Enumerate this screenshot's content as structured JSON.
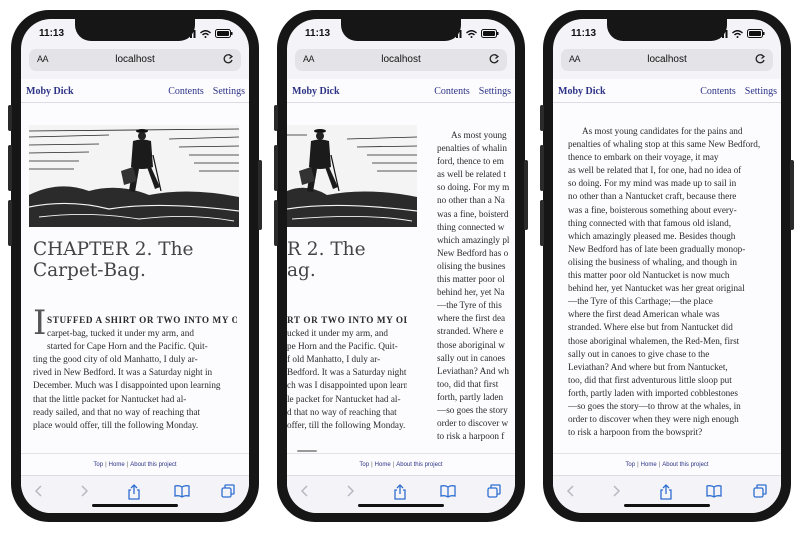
{
  "status": {
    "time": "11:13"
  },
  "browser": {
    "aa_label": "AA",
    "url": "localhost"
  },
  "nav": {
    "title": "Moby Dick",
    "contents": "Contents",
    "settings": "Settings"
  },
  "chapter": {
    "title_line1": "CHAPTER 2. The",
    "title_line2": "Carpet-Bag.",
    "clipped_title_line1": "R 2. The",
    "clipped_title_line2": "ag.",
    "drop_cap": "I",
    "p1_lines": [
      "STUFFED A SHIRT OR TWO INTO MY OLD",
      "carpet-bag, tucked it under my arm, and",
      "started for Cape Horn and the Pacific. Quit-",
      "ting the good city of old Manhatto, I duly ar-",
      "rived in New Bedford. It was a Saturday night in",
      "December. Much was I disappointed upon learning",
      "that the little packet for Nantucket had al-",
      "ready sailed, and that no way of reaching that",
      "place would offer, till the following Monday."
    ],
    "p1_clipped_lines": [
      "RT OR TWO INTO MY OLD",
      "ucked it under my arm, and",
      "pe Horn and the Pacific. Quit-",
      "f old Manhatto, I duly ar-",
      "Bedford. It was a Saturday night in",
      "ch was I disappointed upon learning",
      "le packet for Nantucket had al-",
      "d that no way of reaching that",
      "offer, till the following Monday."
    ],
    "p2_partial_lines": [
      "As most young",
      "penalties of whalin",
      "ford, thence to em",
      "as well be related t",
      "so doing. For my m",
      "no other than a Na",
      "was a fine, boisterd",
      "thing connected w",
      "which amazingly pl",
      "New Bedford has o",
      "olising the busines",
      "this matter poor ol",
      "behind her, yet Na",
      "—the Tyre of this",
      "where the first dea",
      "stranded. Where e",
      "those aboriginal w",
      "sally out in canoes",
      "Leviathan? And wh",
      "too, did that first",
      "forth, partly laden",
      "—so goes the story",
      "order to discover w",
      "to risk a harpoon f"
    ],
    "p2_lines": [
      "As most young candidates for the pains and",
      "penalties of whaling stop at this same New Bedford,",
      "thence to embark on their voyage, it may",
      "as well be related that I, for one, had no idea of",
      "so doing. For my mind was made up to sail in",
      "no other than a Nantucket craft, because there",
      "was a fine, boisterous something about every-",
      "thing connected with that famous old island,",
      "which amazingly pleased me. Besides though",
      "New Bedford has of late been gradually monop-",
      "olising the business of whaling, and though in",
      "this matter poor old Nantucket is now much",
      "behind her, yet Nantucket was her great original",
      "—the Tyre of this Carthage;—the place",
      "where the first dead American whale was",
      "stranded. Where else but from Nantucket did",
      "those aboriginal whalemen, the Red-Men, first",
      "sally out in canoes to give chase to the",
      "Leviathan? And where but from Nantucket,",
      "too, did that first adventurous little sloop put",
      "forth, partly laden with imported cobblestones",
      "—so goes the story—to throw at the whales, in",
      "order to discover when they were nigh enough",
      "to risk a harpoon from the bowsprit?"
    ]
  },
  "footer": {
    "top": "Top",
    "home": "Home",
    "about": "About this project"
  },
  "colors": {
    "link": "#2d3385",
    "chrome": "#f3f3f8",
    "frame": "#161616"
  },
  "icons": [
    "back-icon",
    "forward-icon",
    "share-icon",
    "bookmarks-icon",
    "tabs-icon",
    "reload-icon",
    "signal-icon",
    "wifi-icon",
    "battery-icon"
  ]
}
